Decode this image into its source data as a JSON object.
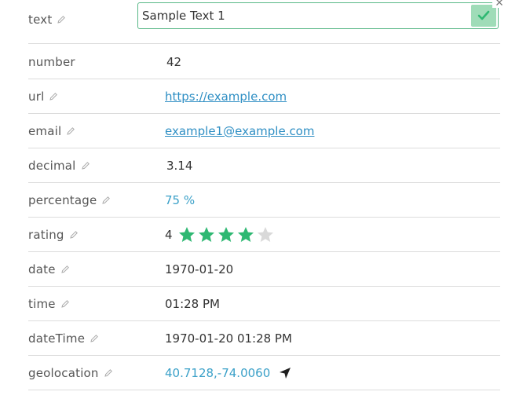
{
  "fields": {
    "text": {
      "label": "text",
      "value": "Sample Text 1"
    },
    "number": {
      "label": "number",
      "value": "42"
    },
    "url": {
      "label": "url",
      "value": "https://example.com"
    },
    "email": {
      "label": "email",
      "value": "example1@example.com"
    },
    "decimal": {
      "label": "decimal",
      "value": "3.14"
    },
    "percentage": {
      "label": "percentage",
      "value": "75 %"
    },
    "rating": {
      "label": "rating",
      "value": "4",
      "max": 5
    },
    "date": {
      "label": "date",
      "value": "1970-01-20"
    },
    "time": {
      "label": "time",
      "value": "01:28 PM"
    },
    "dateTime": {
      "label": "dateTime",
      "value": "1970-01-20 01:28 PM"
    },
    "geolocation": {
      "label": "geolocation",
      "value": "40.7128,-74.0060"
    }
  },
  "colors": {
    "accent_green": "#2eb872",
    "confirm_bg": "#9fdcb8",
    "link_blue": "#2f8fc4",
    "star_empty": "#d9d9d9"
  },
  "icons": {
    "edit": "pencil-icon",
    "confirm": "checkmark-icon",
    "close": "close-icon",
    "navigate": "navigation-arrow-icon",
    "rating": "star-icon"
  }
}
